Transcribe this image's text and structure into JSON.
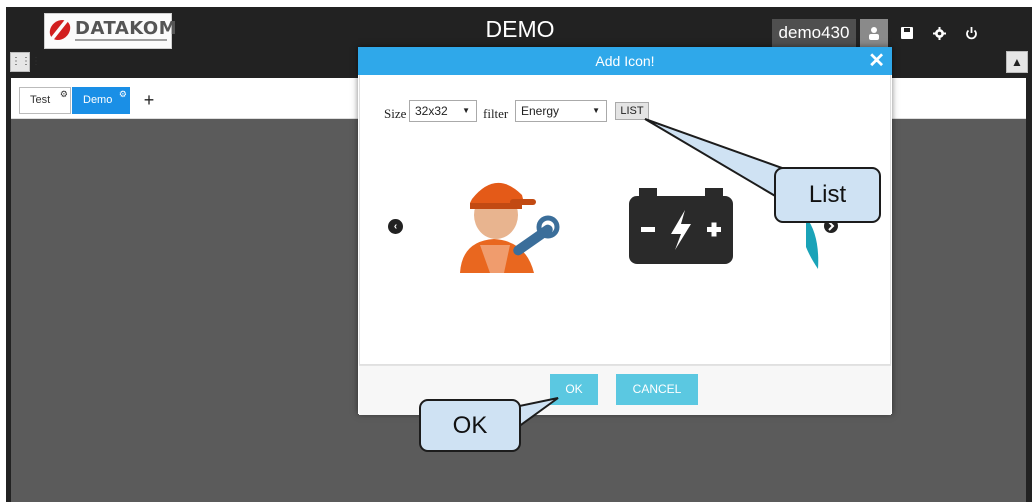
{
  "app": {
    "logo_text": "DATAKOM",
    "title": "DEMO",
    "username": "demo430"
  },
  "toolbar": {
    "icons": [
      "user-icon",
      "save-icon",
      "gear-icon",
      "power-icon",
      "grid-icon",
      "tree-icon"
    ],
    "grid_glyph": "⋮⋮⋮",
    "tree_glyph": "▲"
  },
  "tabs": [
    {
      "label": "Test",
      "active": false
    },
    {
      "label": "Demo",
      "active": true
    }
  ],
  "tab_add_glyph": "+",
  "modal": {
    "title": "Add Icon!",
    "close_glyph": "✕",
    "size_label": "Size",
    "size_value": "32x32",
    "filter_label": "filter",
    "filter_value": "Energy",
    "list_button": "LIST",
    "prev_glyph": "‹",
    "ok_button": "OK",
    "cancel_button": "CANCEL",
    "icons": [
      "mechanic-icon",
      "battery-icon",
      "partial-icon"
    ]
  },
  "callouts": {
    "list": "List",
    "ok": "OK"
  },
  "colors": {
    "header_bg": "#222222",
    "modal_header": "#2fa8ea",
    "active_tab": "#1a8fe6",
    "button": "#5bc8e1",
    "callout_fill": "#cfe2f3",
    "canvas": "#5b5b5b"
  }
}
